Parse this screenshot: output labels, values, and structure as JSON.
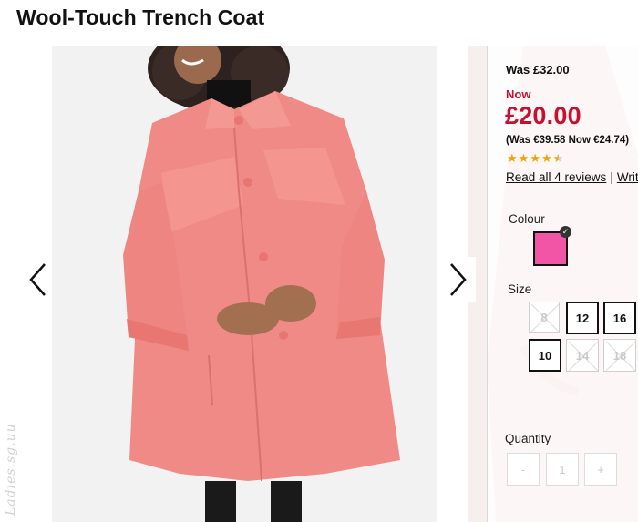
{
  "product": {
    "title": "Wool-Touch Trench Coat"
  },
  "pricing": {
    "was": "Was £32.00",
    "now_label": "Now",
    "now_price": "£20.00",
    "euro_line": "(Was €39.58 Now €24.74)"
  },
  "rating": {
    "stars": 4.5,
    "out_of": 5,
    "read_reviews": "Read all 4 reviews",
    "separator": "|",
    "write_review": "Write a review"
  },
  "colour": {
    "label": "Colour",
    "selected_hex": "#f254a6",
    "coat_hex": "#f08a86"
  },
  "size": {
    "label": "Size",
    "options": [
      {
        "value": "8",
        "available": false
      },
      {
        "value": "12",
        "available": true
      },
      {
        "value": "16",
        "available": true
      },
      {
        "value": "10",
        "available": true
      },
      {
        "value": "14",
        "available": false
      },
      {
        "value": "18",
        "available": false
      }
    ]
  },
  "quantity": {
    "label": "Quantity",
    "minus": "-",
    "value": "1",
    "plus": "+"
  },
  "watermark": "Ladies.sg.uu",
  "icons": {
    "prev": "chevron-left-icon",
    "next": "chevron-right-icon"
  }
}
